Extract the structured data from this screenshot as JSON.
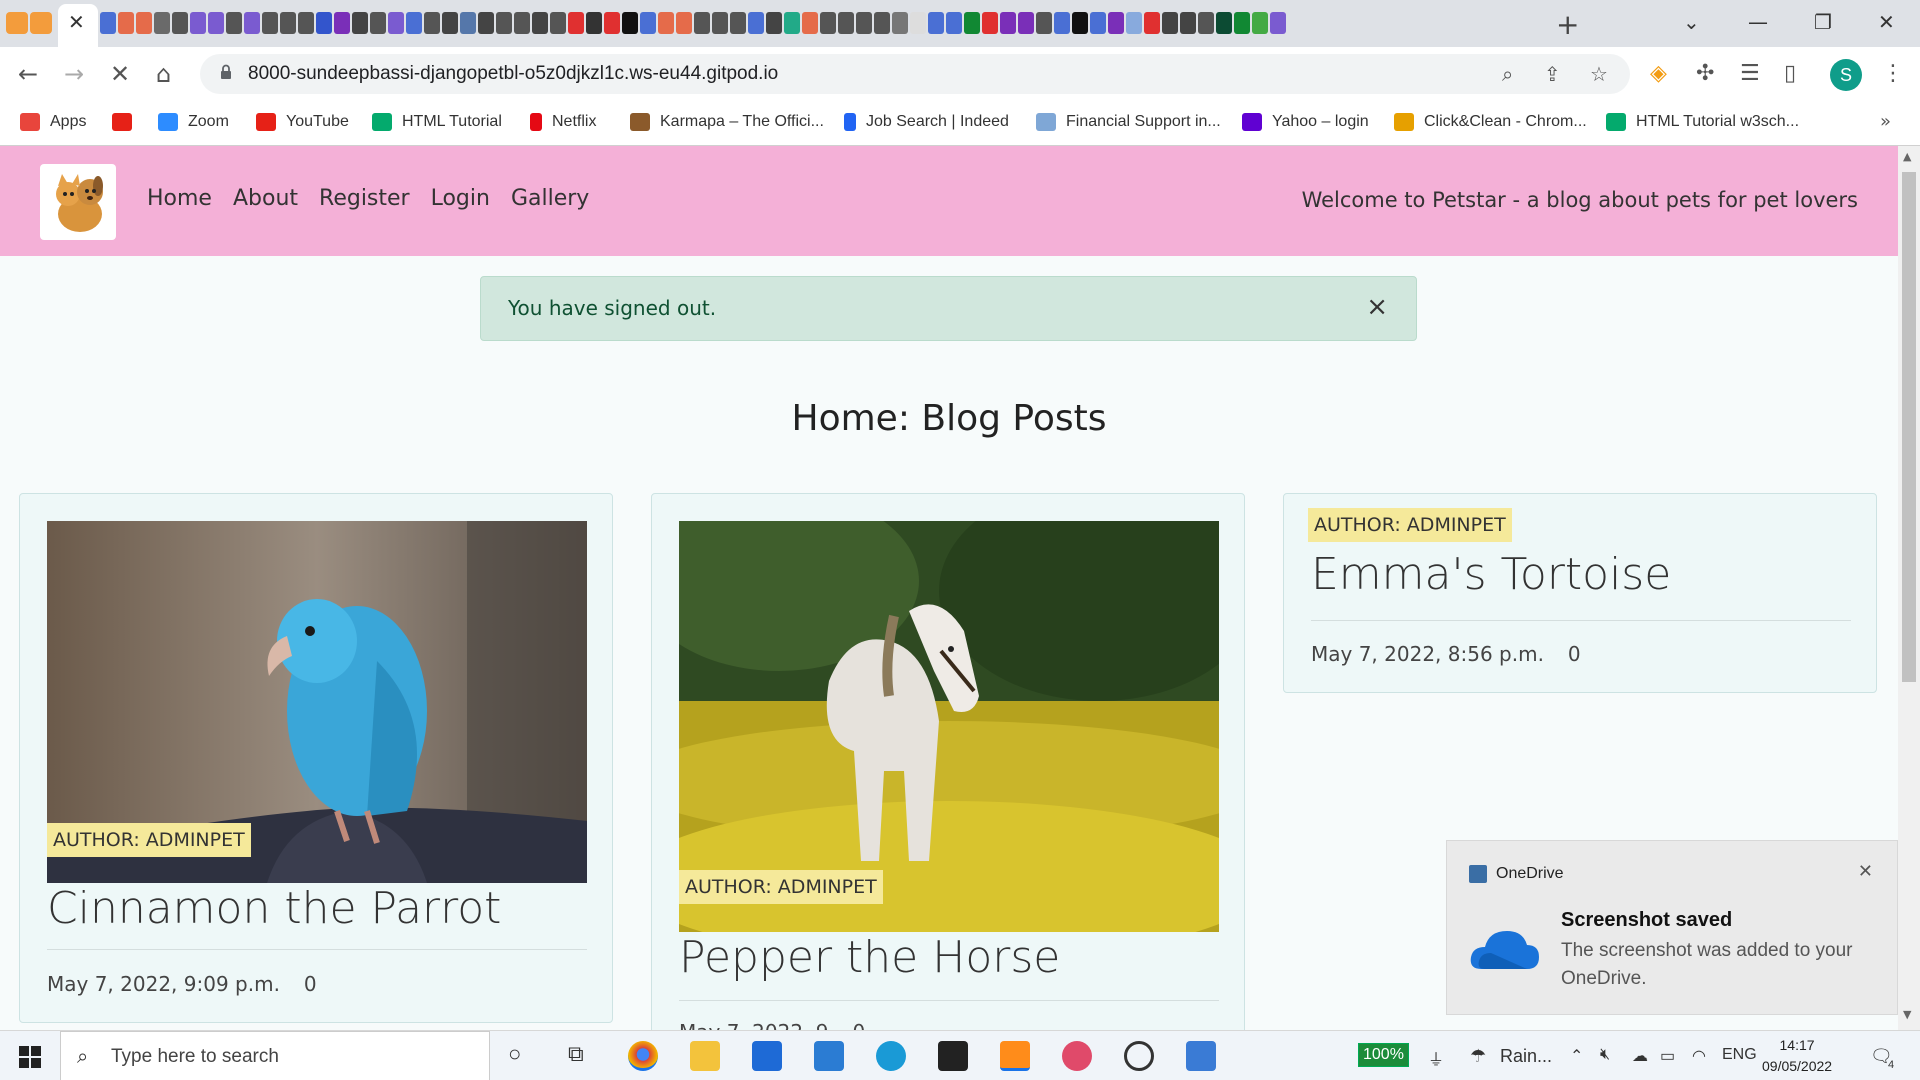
{
  "browser": {
    "url": "8000-sundeepbassi-djangopetbl-o5z0djkzl1c.ws-eu44.gitpod.io",
    "profile_initial": "S",
    "bookmarks": [
      {
        "label": "Apps",
        "color": "#e8453c"
      },
      {
        "label": "",
        "color": "#e62117"
      },
      {
        "label": "Zoom",
        "color": "#2d8cff"
      },
      {
        "label": "YouTube",
        "color": "#e62117"
      },
      {
        "label": "HTML Tutorial",
        "color": "#04aa6d"
      },
      {
        "label": "Netflix",
        "color": "#e50914"
      },
      {
        "label": "Karmapa – The Offici...",
        "color": "#8b5a2b"
      },
      {
        "label": "Job Search | Indeed",
        "color": "#2164f3"
      },
      {
        "label": "Financial Support in...",
        "color": "#7fa7d6"
      },
      {
        "label": "Yahoo – login",
        "color": "#6001d2"
      },
      {
        "label": "Click&Clean - Chrom...",
        "color": "#e6a000"
      },
      {
        "label": "HTML Tutorial w3sch...",
        "color": "#04aa6d"
      }
    ]
  },
  "navbar": {
    "links": [
      "Home",
      "About",
      "Register",
      "Login",
      "Gallery"
    ],
    "welcome": "Welcome to Petstar - a blog about pets for pet lovers"
  },
  "alert": {
    "message": "You have signed out.",
    "close": "×"
  },
  "page": {
    "title": "Home: Blog Posts"
  },
  "posts": [
    {
      "title": "Cinnamon the Parrot",
      "author": "AUTHOR: ADMINPET",
      "date": "May 7, 2022, 9:09 p.m.",
      "likes": "0",
      "image": "parrot"
    },
    {
      "title": "Pepper the Horse",
      "author": "AUTHOR: ADMINPET",
      "date": "May 7, 2022, 9",
      "likes": "0",
      "image": "horse"
    },
    {
      "title": "Emma's Tortoise",
      "author": "AUTHOR: ADMINPET",
      "date": "May 7, 2022, 8:56 p.m.",
      "likes": "0",
      "image": null
    }
  ],
  "toast": {
    "app": "OneDrive",
    "title": "Screenshot saved",
    "body": "The screenshot was added to your OneDrive."
  },
  "taskbar": {
    "search_placeholder": "Type here to search",
    "battery": "100%",
    "weather": "Rain...",
    "language": "ENG",
    "time": "14:17",
    "date": "09/05/2022",
    "notifications": "4"
  },
  "colors": {
    "navbar": "#f4b0d7",
    "alert_bg": "#d1e7dd",
    "author_badge": "#f5e99a",
    "card_bg": "#eef8f8"
  }
}
